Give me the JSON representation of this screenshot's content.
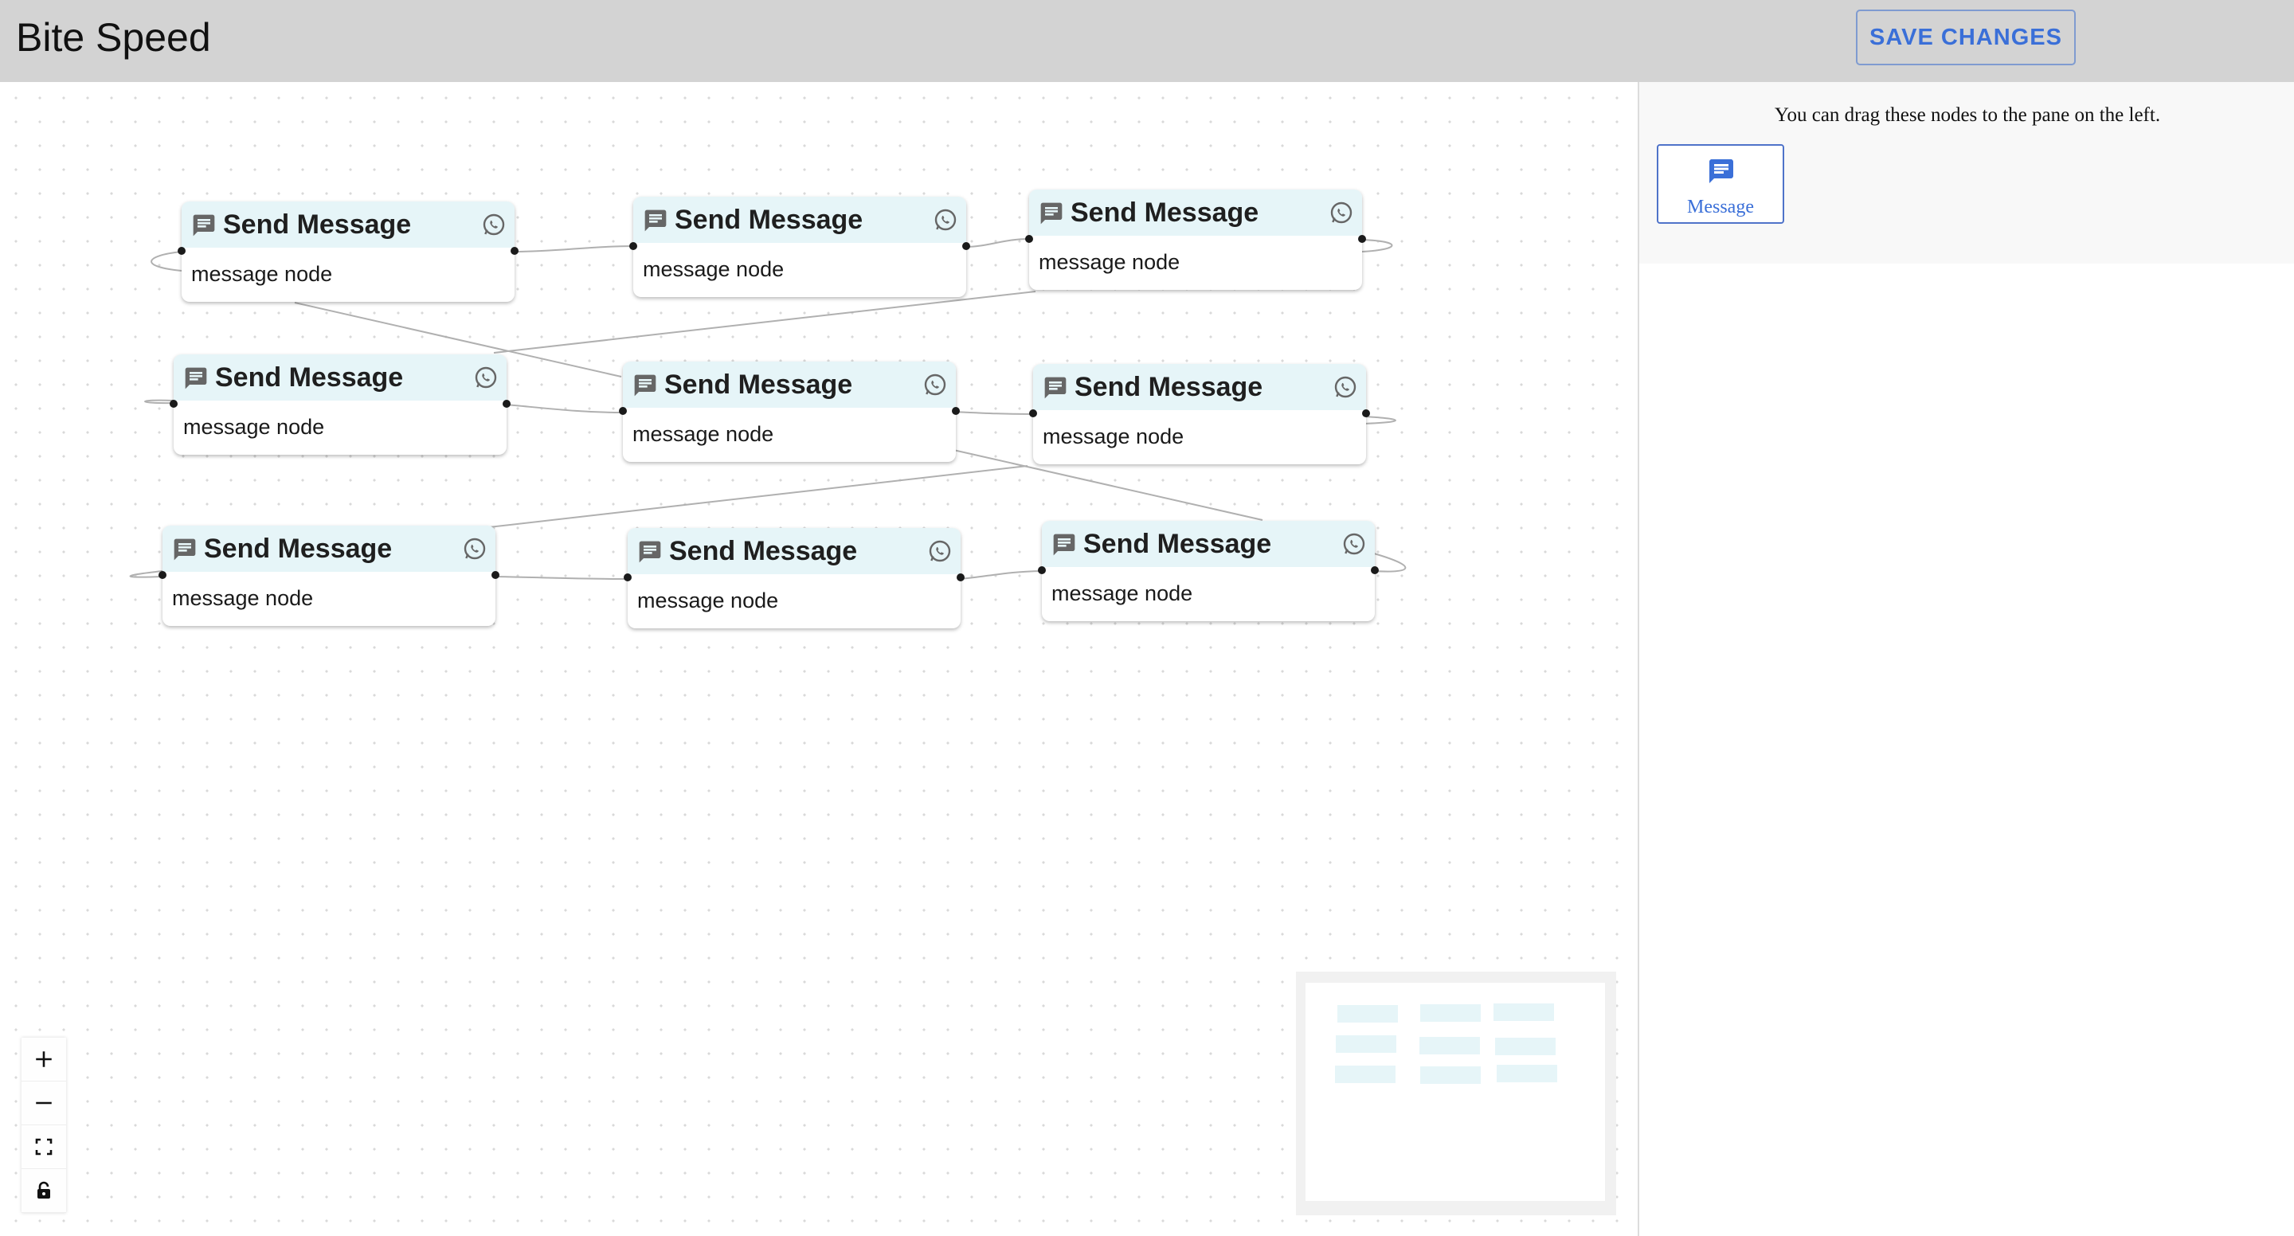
{
  "header": {
    "title": "Bite Speed",
    "save_label": "SAVE CHANGES"
  },
  "sidebar": {
    "hint": "You can drag these nodes to the pane on the left.",
    "palette": [
      {
        "label": "Message",
        "icon": "message-icon"
      }
    ]
  },
  "flow": {
    "nodes": [
      {
        "title": "Send Message",
        "body": "message node"
      },
      {
        "title": "Send Message",
        "body": "message node"
      },
      {
        "title": "Send Message",
        "body": "message node"
      },
      {
        "title": "Send Message",
        "body": "message node"
      },
      {
        "title": "Send Message",
        "body": "message node"
      },
      {
        "title": "Send Message",
        "body": "message node"
      },
      {
        "title": "Send Message",
        "body": "message node"
      },
      {
        "title": "Send Message",
        "body": "message node"
      },
      {
        "title": "Send Message",
        "body": "message node"
      }
    ]
  },
  "controls": [
    {
      "name": "zoom-in",
      "icon": "plus-icon"
    },
    {
      "name": "zoom-out",
      "icon": "minus-icon"
    },
    {
      "name": "fit-view",
      "icon": "fit-view-icon"
    },
    {
      "name": "lock",
      "icon": "lock-icon"
    }
  ],
  "colors": {
    "header_bg": "#d3d3d3",
    "accent": "#3a6fd8",
    "node_header_bg": "#e6f5f8",
    "edge": "#b0b0b0"
  }
}
